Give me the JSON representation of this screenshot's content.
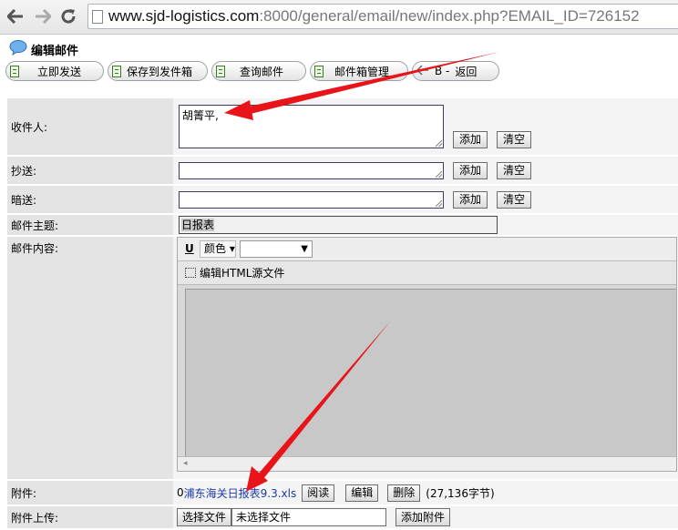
{
  "browser": {
    "url_host": "www.sjd-logistics.com",
    "url_path": ":8000/general/email/new/index.php?EMAIL_ID=726152"
  },
  "page": {
    "title": "编辑邮件"
  },
  "toolbar": {
    "send": "立即发送",
    "save_outbox": "保存到发件箱",
    "query": "查询邮件",
    "manage": "邮件箱管理",
    "back": "返回",
    "back_prefix": "B -"
  },
  "form": {
    "to_label": "收件人:",
    "to_value": "胡箐平,",
    "cc_label": "抄送:",
    "bcc_label": "暗送:",
    "add_btn": "添加",
    "clear_btn": "清空",
    "subject_label": "邮件主题:",
    "subject_value": "日报表",
    "content_label": "邮件内容:",
    "attachment_label": "附件:",
    "upload_label": "附件上传:"
  },
  "editor": {
    "bold_u": "U",
    "color_label": "颜色",
    "source_toggle": "编辑HTML源文件"
  },
  "attachment": {
    "prefix": "0",
    "filename": "浦东海关日报表9.3.xls",
    "read_btn": "阅读",
    "edit_btn": "编辑",
    "delete_btn": "删除",
    "size": "(27,136字节)"
  },
  "upload": {
    "choose_btn": "选择文件",
    "no_file": "未选择文件",
    "add_btn": "添加附件"
  },
  "colors": {
    "arrow": "#e8141a",
    "link": "#1a3aa8"
  }
}
